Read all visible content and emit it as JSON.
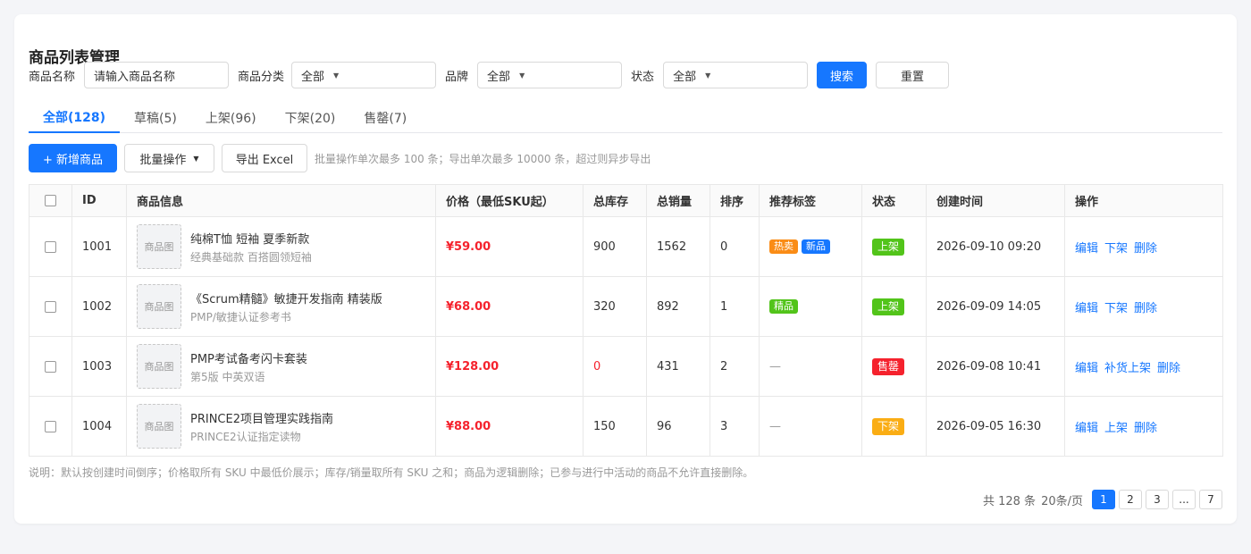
{
  "page_title": "商品列表管理",
  "filters": {
    "name_label": "商品名称",
    "name_placeholder": "请输入商品名称",
    "category_label": "商品分类",
    "category_value": "全部",
    "brand_label": "品牌",
    "brand_value": "全部",
    "status_label": "状态",
    "status_value": "全部",
    "search_label": "搜索",
    "reset_label": "重置"
  },
  "tabs": [
    {
      "label": "全部(128)",
      "active": true
    },
    {
      "label": "草稿(5)"
    },
    {
      "label": "上架(96)"
    },
    {
      "label": "下架(20)"
    },
    {
      "label": "售罄(7)"
    }
  ],
  "toolbar": {
    "add_label": "+ 新增商品",
    "batch_label": "批量操作",
    "export_label": "导出 Excel",
    "hint": "批量操作单次最多 100 条；导出单次最多 10000 条，超过则异步导出"
  },
  "table": {
    "columns": [
      "ID",
      "商品信息",
      "价格（最低SKU起）",
      "总库存",
      "总销量",
      "排序",
      "推荐标签",
      "状态",
      "创建时间",
      "操作"
    ],
    "thumb_placeholder": "商品图",
    "rows": [
      {
        "id": "1001",
        "name": "纯棉T恤 短袖 夏季新款",
        "sub": "经典基础款 百搭圆领短袖",
        "price": "¥59.00",
        "stock": "900",
        "sales": "1562",
        "sort": "0",
        "tags": [
          "热卖",
          "新品"
        ],
        "status": "上架",
        "created": "2026-09-10 09:20",
        "ops": [
          "编辑",
          "下架",
          "删除"
        ]
      },
      {
        "id": "1002",
        "name": "《Scrum精髓》敏捷开发指南 精装版",
        "sub": "PMP/敏捷认证参考书",
        "price": "¥68.00",
        "stock": "320",
        "sales": "892",
        "sort": "1",
        "tags": [
          "精品"
        ],
        "status": "上架",
        "created": "2026-09-09 14:05",
        "ops": [
          "编辑",
          "下架",
          "删除"
        ]
      },
      {
        "id": "1003",
        "name": "PMP考试备考闪卡套装",
        "sub": "第5版 中英双语",
        "price": "¥128.00",
        "stock": "0",
        "sales": "431",
        "sort": "2",
        "tags": [],
        "status": "售罄",
        "created": "2026-09-08 10:41",
        "ops": [
          "编辑",
          "补货上架",
          "删除"
        ]
      },
      {
        "id": "1004",
        "name": "PRINCE2项目管理实践指南",
        "sub": "PRINCE2认证指定读物",
        "price": "¥88.00",
        "stock": "150",
        "sales": "96",
        "sort": "3",
        "tags": [],
        "status": "下架",
        "created": "2026-09-05 16:30",
        "ops": [
          "编辑",
          "上架",
          "删除"
        ]
      }
    ],
    "empty_tag": "—"
  },
  "colors": {
    "primary": "#1677ff",
    "tag_hot": "#fa8c16",
    "tag_new": "#1677ff",
    "tag_premium": "#52c41a",
    "status_on": "#52c41a",
    "status_soldout": "#f5222d",
    "status_off": "#faad14"
  },
  "note": "说明：默认按创建时间倒序；价格取所有 SKU 中最低价展示；库存/销量取所有 SKU 之和；商品为逻辑删除；已参与进行中活动的商品不允许直接删除。",
  "pagination": {
    "total_text": "共 128 条",
    "page_size_text": "20条/页",
    "pages": [
      "1",
      "2",
      "3",
      "...",
      "7"
    ],
    "current": "1"
  }
}
